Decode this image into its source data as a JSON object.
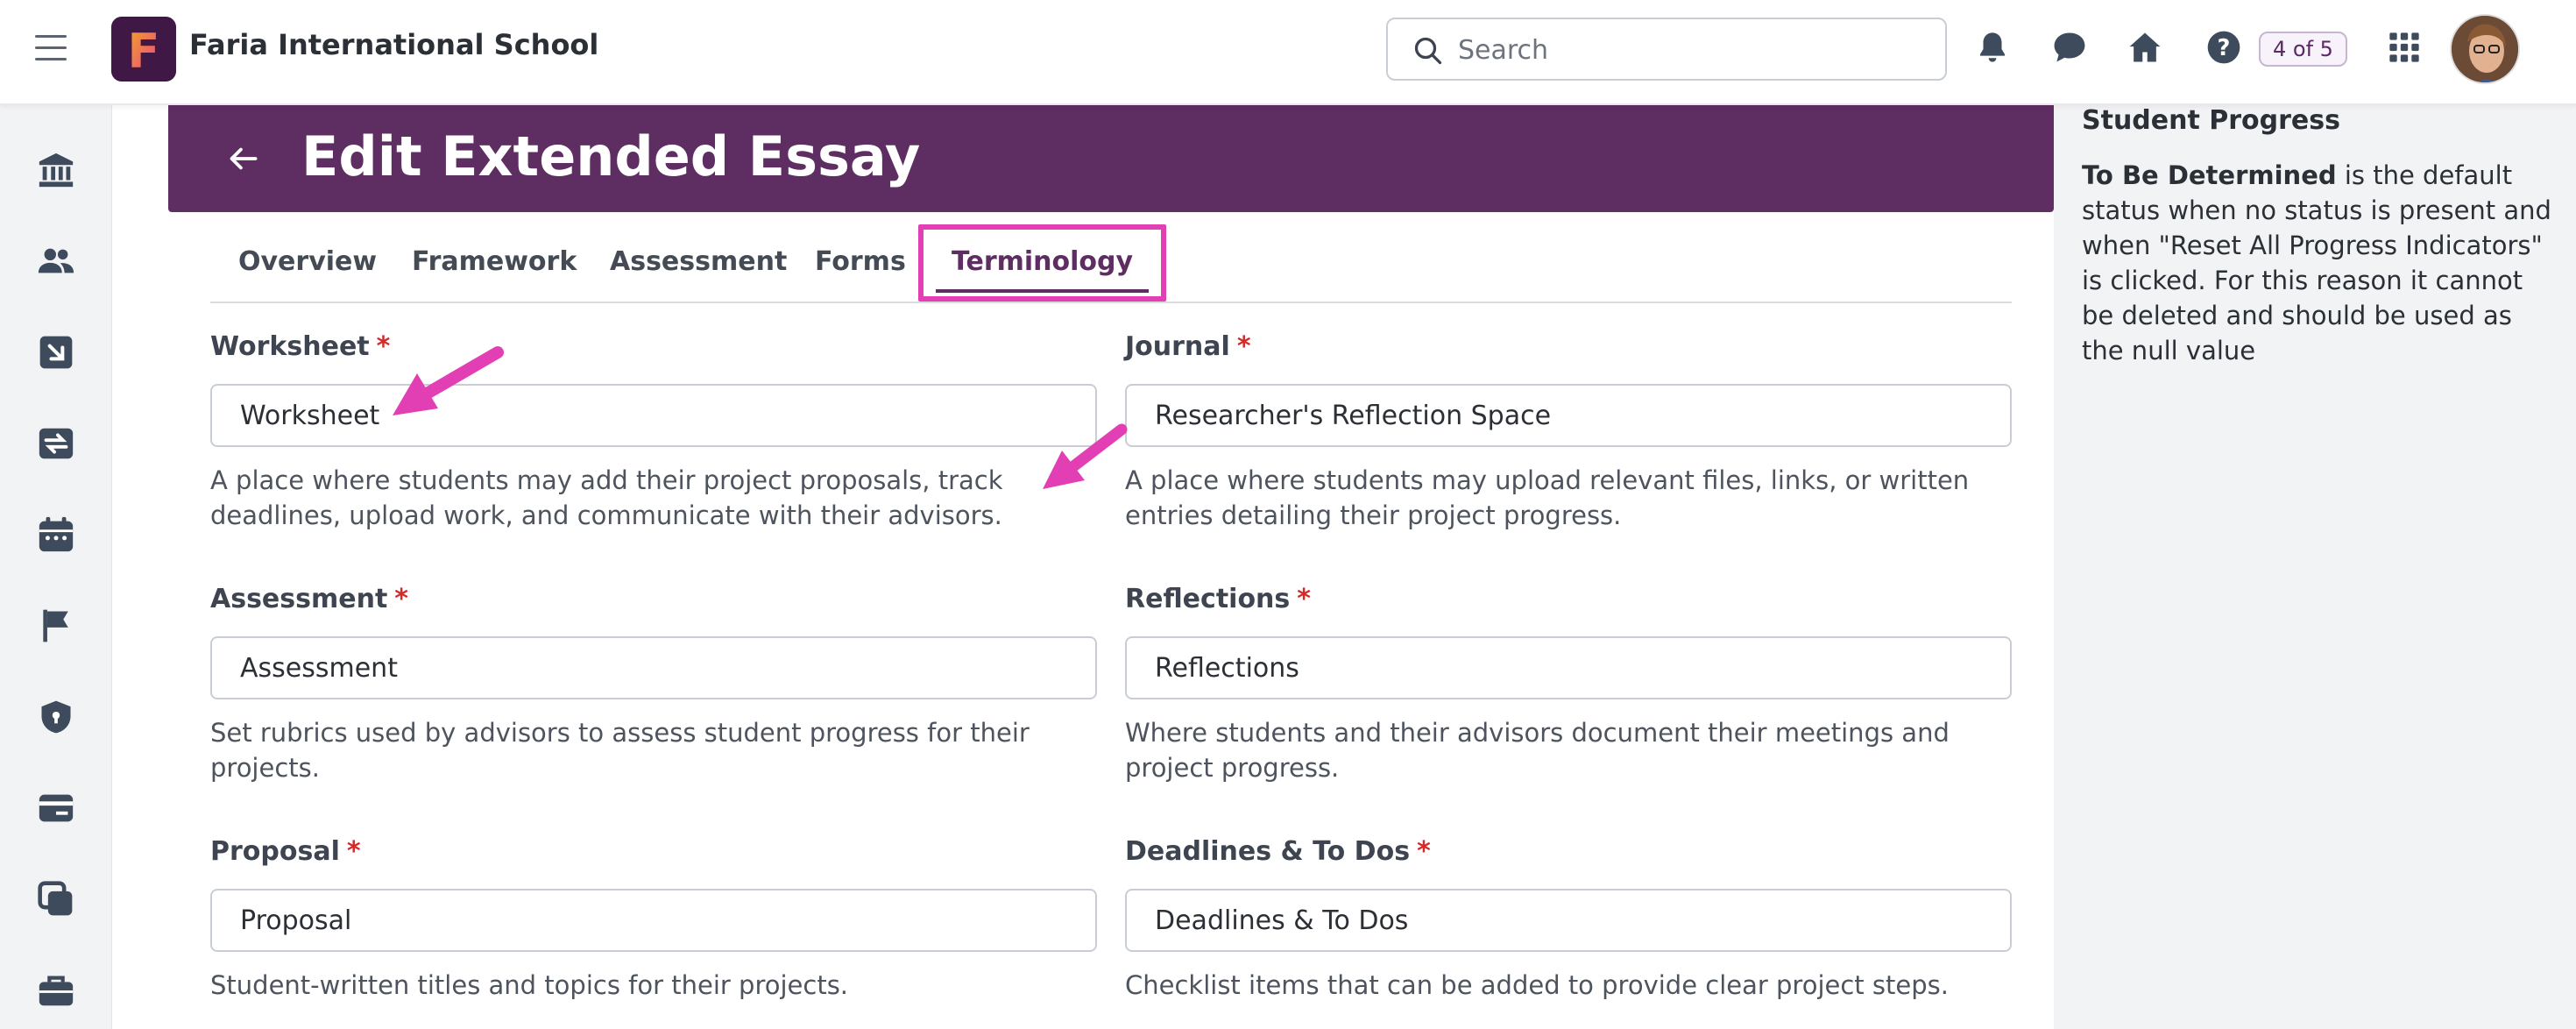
{
  "topbar": {
    "school_name": "Faria International School",
    "search_placeholder": "Search",
    "page_indicator": "4 of 5",
    "logo_letter": "F"
  },
  "header": {
    "title": "Edit Extended Essay"
  },
  "tabs": [
    {
      "label": "Overview"
    },
    {
      "label": "Framework"
    },
    {
      "label": "Assessment"
    },
    {
      "label": "Forms"
    },
    {
      "label": "Terminology"
    }
  ],
  "active_tab": "Terminology",
  "fields": {
    "worksheet": {
      "label": "Worksheet",
      "required_mark": "*",
      "value": "Worksheet",
      "help": "A place where students may add their project proposals, track deadlines, upload work, and communicate with their advisors."
    },
    "journal": {
      "label": "Journal",
      "required_mark": "*",
      "value": "Researcher's Reflection Space",
      "help": "A place where students may upload relevant files, links, or written entries detailing their project progress."
    },
    "assessment": {
      "label": "Assessment",
      "required_mark": "*",
      "value": "Assessment",
      "help": "Set rubrics used by advisors to assess student progress for their projects."
    },
    "reflections": {
      "label": "Reflections",
      "required_mark": "*",
      "value": "Reflections",
      "help": "Where students and their advisors document their meetings and project progress."
    },
    "proposal": {
      "label": "Proposal",
      "required_mark": "*",
      "value": "Proposal",
      "help": "Student-written titles and topics for their projects."
    },
    "deadlines": {
      "label": "Deadlines & To Dos",
      "required_mark": "*",
      "value": "Deadlines & To Dos",
      "help": "Checklist items that can be added to provide clear project steps."
    }
  },
  "side_panel": {
    "title": "Student Progress",
    "bold_lead": "To Be Determined",
    "body": " is the default status when no status is present and when \"Reset All Progress Indicators\" is clicked. For this reason it cannot be deleted and should be used as the null value"
  },
  "rail_icons": [
    "bank-icon",
    "people-icon",
    "arrow-in-box-icon",
    "exchange-card-icon",
    "calendar-icon",
    "flag-icon",
    "shield-lock-icon",
    "card-icon",
    "copy-icon",
    "briefcase-icon"
  ],
  "colors": {
    "brand_purple": "#5e2d62",
    "highlight_pink": "#e23fb4",
    "required_red": "#d42a2a",
    "icon_slate": "#3d4b5c"
  }
}
